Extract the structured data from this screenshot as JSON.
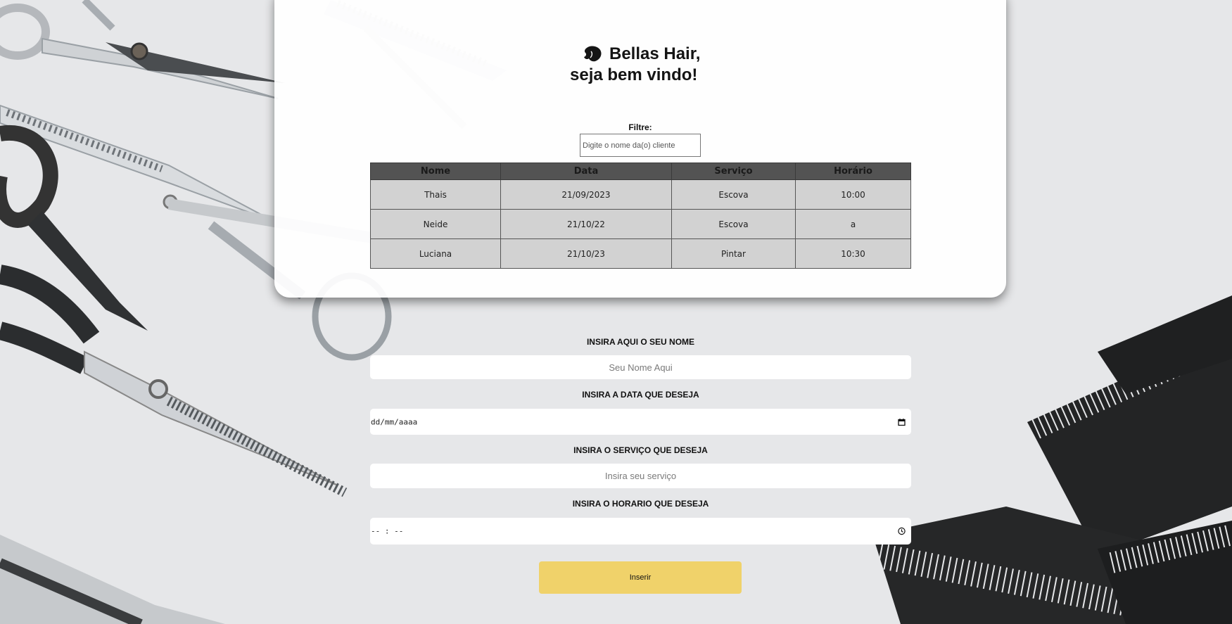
{
  "header": {
    "brand_line": "Bellas Hair,",
    "welcome_line": "seja bem vindo!",
    "logo_icon": "hair-silhouette-icon"
  },
  "filter": {
    "label": "Filtre:",
    "placeholder": "Digite o nome da(o) cliente"
  },
  "table": {
    "headers": [
      "Nome",
      "Data",
      "Serviço",
      "Horário"
    ],
    "rows": [
      [
        "Thais",
        "21/09/2023",
        "Escova",
        "10:00"
      ],
      [
        "Neide",
        "21/10/22",
        "Escova",
        "a"
      ],
      [
        "Luciana",
        "21/10/23",
        "Pintar",
        "10:30"
      ]
    ]
  },
  "form": {
    "name_label": "INSIRA AQUI O SEU NOME",
    "name_placeholder": "Seu Nome Aqui",
    "date_label": "INSIRA A DATA QUE DESEJA",
    "date_mask": "dd/mm/aaaa",
    "service_label": "INSIRA O SERVIÇO QUE DESEJA",
    "service_placeholder": "Insira seu serviço",
    "time_label": "INSIRA O HORARIO QUE DESEJA",
    "time_mask": "-- : --",
    "submit_label": "Inserir"
  },
  "colors": {
    "button": "#f0d26a",
    "table_header": "#535353",
    "table_cell": "#d2d2d2",
    "background": "#e6e7e9"
  }
}
